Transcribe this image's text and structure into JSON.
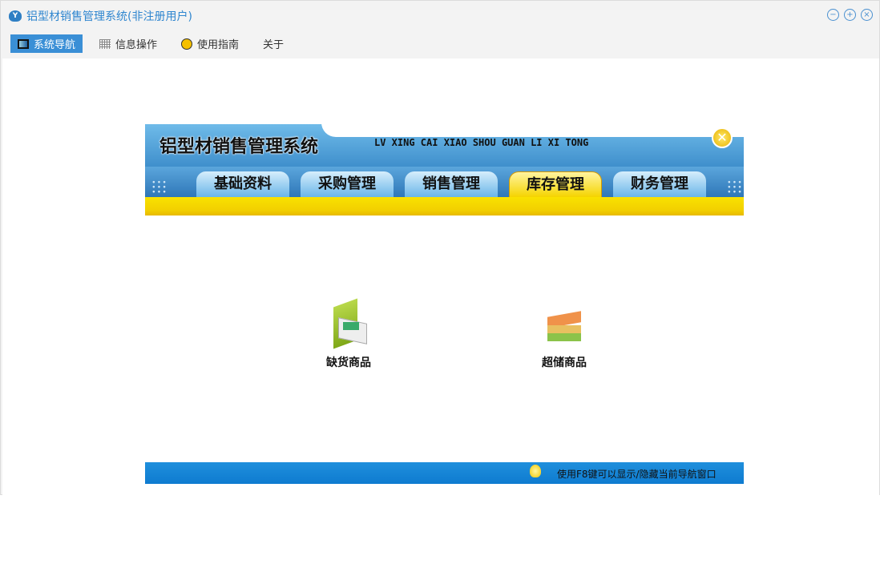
{
  "window": {
    "title": "铝型材销售管理系统(非注册用户)",
    "controls": [
      "minimize",
      "maximize",
      "close"
    ]
  },
  "menu": [
    {
      "label": "系统导航",
      "icon": "monitor-icon",
      "active": true
    },
    {
      "label": "信息操作",
      "icon": "grid-icon"
    },
    {
      "label": "使用指南",
      "icon": "help-icon"
    },
    {
      "label": "关于"
    }
  ],
  "banner": {
    "title": "铝型材销售管理系统",
    "pinyin": "LV XING CAI XIAO SHOU GUAN LI XI TONG",
    "tabs": [
      {
        "label": "基础资料"
      },
      {
        "label": "采购管理"
      },
      {
        "label": "销售管理"
      },
      {
        "label": "库存管理",
        "active": true
      },
      {
        "label": "财务管理"
      }
    ]
  },
  "items": [
    {
      "label": "缺货商品",
      "icon": "shortage-goods-icon"
    },
    {
      "label": "超储商品",
      "icon": "overstock-goods-icon"
    }
  ],
  "footer": {
    "tip": "使用F8键可以显示/隐藏当前导航窗口"
  }
}
